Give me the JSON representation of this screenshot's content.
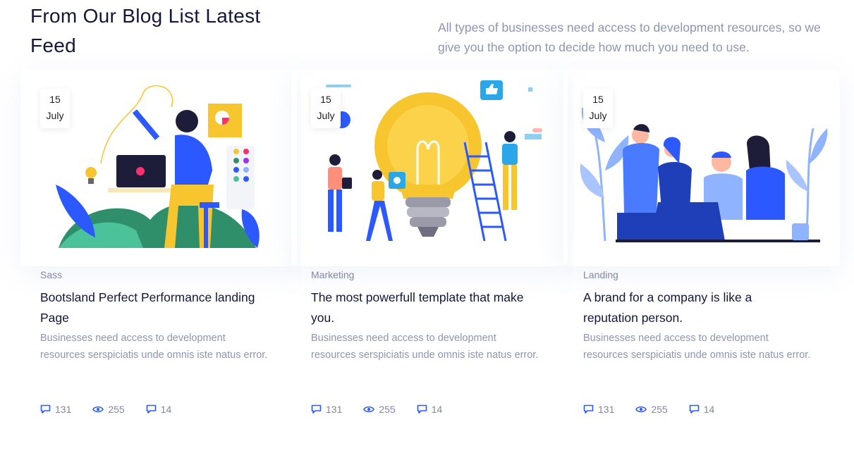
{
  "section": {
    "title": "From Our Blog List Latest Feed",
    "description": "All types of businesses need access to development resources, so we give you the option to decide how much you need to use."
  },
  "colors": {
    "accent": "#2b59ff",
    "heading": "#14163a",
    "muted": "#8f94b0"
  },
  "cards": [
    {
      "date_day": "15",
      "date_month": "July",
      "category": "Sass",
      "title": "Bootsland Perfect Performance landing Page",
      "excerpt": "Businesses need access to development resources serspiciatis unde omnis iste natus error.",
      "comments": "131",
      "views": "255",
      "shares": "14",
      "illustration": "person-at-laptop-illustration"
    },
    {
      "date_day": "15",
      "date_month": "July",
      "category": "Marketing",
      "title": "The most powerfull template that make you.",
      "excerpt": "Businesses need access to development resources serspiciatis unde omnis iste natus error.",
      "comments": "131",
      "views": "255",
      "shares": "14",
      "illustration": "lightbulb-team-illustration"
    },
    {
      "date_day": "15",
      "date_month": "July",
      "category": "Landing",
      "title": "A brand for a company is like a reputation person.",
      "excerpt": "Businesses need access to development resources serspiciatis unde omnis iste natus error.",
      "comments": "131",
      "views": "255",
      "shares": "14",
      "illustration": "team-meeting-illustration"
    }
  ]
}
